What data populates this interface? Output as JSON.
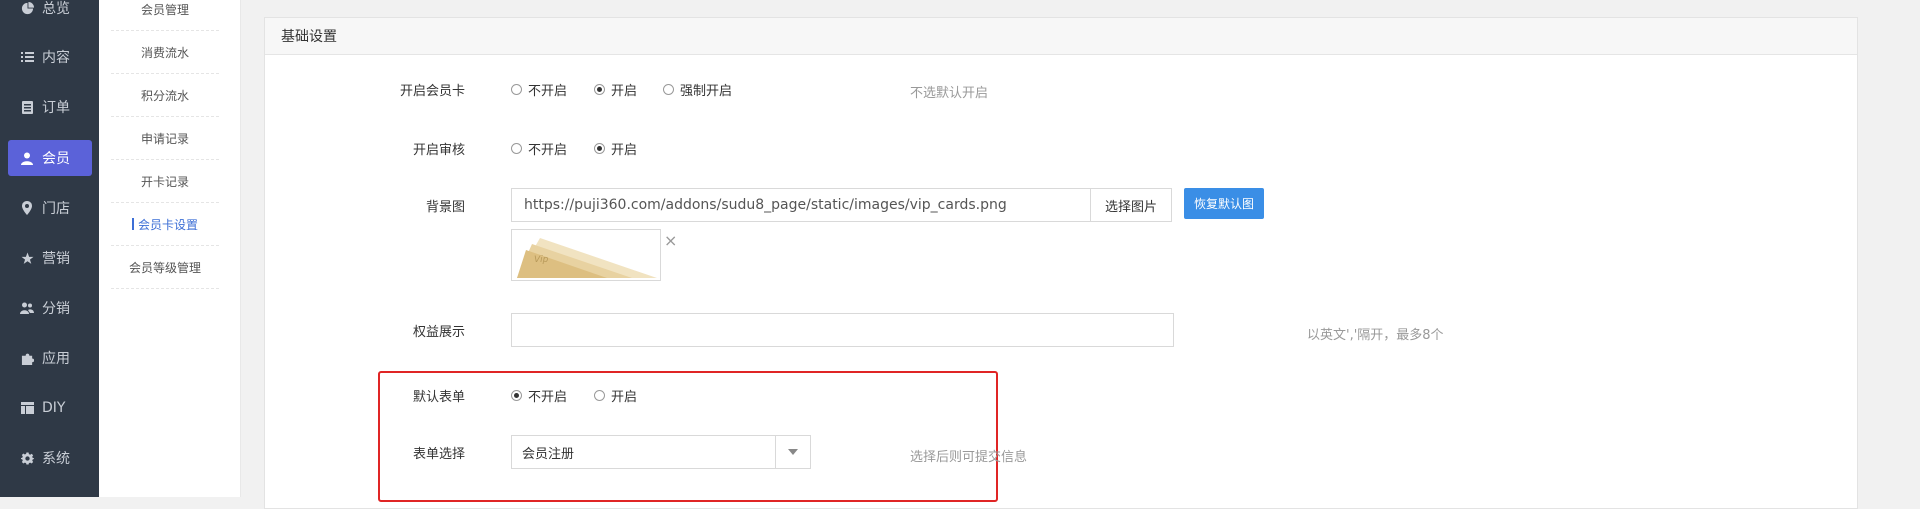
{
  "nav": {
    "items": [
      {
        "label": "总览",
        "icon": "pie-chart-icon"
      },
      {
        "label": "内容",
        "icon": "list-icon"
      },
      {
        "label": "订单",
        "icon": "document-icon"
      },
      {
        "label": "会员",
        "icon": "user-icon",
        "active": true
      },
      {
        "label": "门店",
        "icon": "location-pin-icon"
      },
      {
        "label": "营销",
        "icon": "star-icon"
      },
      {
        "label": "分销",
        "icon": "users-icon"
      },
      {
        "label": "应用",
        "icon": "puzzle-icon"
      },
      {
        "label": "DIY",
        "icon": "table-icon"
      },
      {
        "label": "系统",
        "icon": "gear-icon"
      }
    ]
  },
  "subnav": {
    "items": [
      {
        "label": "会员管理"
      },
      {
        "label": "消费流水"
      },
      {
        "label": "积分流水"
      },
      {
        "label": "申请记录"
      },
      {
        "label": "开卡记录"
      },
      {
        "label": "会员卡设置",
        "active": true
      },
      {
        "label": "会员等级管理"
      }
    ]
  },
  "panel": {
    "title": "基础设置",
    "card_enable": {
      "label": "开启会员卡",
      "options": [
        "不开启",
        "开启",
        "强制开启"
      ],
      "selected": 1,
      "hint": "不选默认开启"
    },
    "audit_enable": {
      "label": "开启审核",
      "options": [
        "不开启",
        "开启"
      ],
      "selected": 1
    },
    "background": {
      "label": "背景图",
      "url": "https://puji360.com/addons/sudu8_page/static/images/vip_cards.png",
      "choose_label": "选择图片",
      "restore_label": "恢复默认图",
      "thumb_text": "Vip"
    },
    "rights": {
      "label": "权益展示",
      "value": "",
      "hint": "以英文','隔开，最多8个"
    },
    "default_form": {
      "label": "默认表单",
      "options": [
        "不开启",
        "开启"
      ],
      "selected": 0
    },
    "form_select": {
      "label": "表单选择",
      "value": "会员注册",
      "hint": "选择后则可提交信息"
    }
  },
  "colors": {
    "nav_bg": "#2f3946",
    "nav_active": "#5b62d9",
    "primary_button": "#3a8ee6",
    "highlight_border": "#e02525",
    "subnav_active": "#3d6fd6"
  }
}
